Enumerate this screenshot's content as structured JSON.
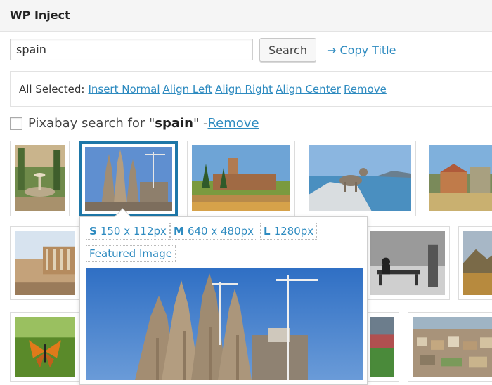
{
  "title": "WP Inject",
  "search": {
    "value": "spain",
    "button_label": "Search",
    "copy_title_label": "→ Copy Title"
  },
  "selection": {
    "label": "All Selected:",
    "actions": [
      "Insert Normal",
      "Align Left",
      "Align Right",
      "Align Center",
      "Remove"
    ]
  },
  "pixabay": {
    "prefix": "Pixabay search for \"",
    "term": "spain",
    "suffix": "\" - ",
    "remove_label": "Remove"
  },
  "popup": {
    "sizes": [
      {
        "key": "S",
        "label": "150 x 112px"
      },
      {
        "key": "M",
        "label": "640 x 480px"
      },
      {
        "key": "L",
        "label": "1280px"
      }
    ],
    "featured_label": "Featured Image"
  },
  "colors": {
    "accent": "#2e8bc0",
    "selected_border": "#1e77a8"
  }
}
